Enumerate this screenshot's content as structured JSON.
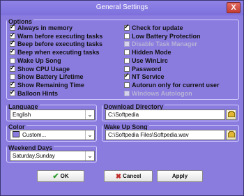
{
  "window": {
    "title": "General Settings",
    "close_label": "X"
  },
  "options": {
    "group_title": "Options",
    "left_items": [
      {
        "label": "Always in memory",
        "checked": true,
        "disabled": false
      },
      {
        "label": "Warn before executing tasks",
        "checked": true,
        "disabled": false
      },
      {
        "label": "Beep before executing tasks",
        "checked": true,
        "disabled": false
      },
      {
        "label": "Beep when executing tasks",
        "checked": true,
        "disabled": false
      },
      {
        "label": "Wake Up Song",
        "checked": false,
        "disabled": false
      },
      {
        "label": "Show CPU Usage",
        "checked": true,
        "disabled": false
      },
      {
        "label": "Show Battery Lifetime",
        "checked": false,
        "disabled": false
      },
      {
        "label": "Show Remaining Time",
        "checked": true,
        "disabled": false
      },
      {
        "label": "Balloon Hints",
        "checked": true,
        "disabled": false
      }
    ],
    "right_items": [
      {
        "label": "Check for update",
        "checked": true,
        "disabled": false
      },
      {
        "label": "Low Battery Protection",
        "checked": false,
        "disabled": false
      },
      {
        "label": "Disable Task Manager",
        "checked": false,
        "disabled": true
      },
      {
        "label": "Hidden Mode",
        "checked": false,
        "disabled": false
      },
      {
        "label": "Use WinLirc",
        "checked": false,
        "disabled": false
      },
      {
        "label": "Password",
        "checked": false,
        "disabled": false
      },
      {
        "label": "NT Service",
        "checked": true,
        "disabled": false
      },
      {
        "label": "Autorun only for current user",
        "checked": false,
        "disabled": false
      },
      {
        "label": "Windows Autologon",
        "checked": false,
        "disabled": true
      }
    ]
  },
  "language": {
    "group_title": "Language",
    "selected": "English"
  },
  "color": {
    "group_title": "Color",
    "selected": "Custom...",
    "swatch_color": "#8a7bdf"
  },
  "weekend_days": {
    "group_title": "Weekend Days",
    "selected": "Saturday,Sunday"
  },
  "download_directory": {
    "group_title": "Download Directory",
    "value": "C:\\Softpedia"
  },
  "wake_up_song": {
    "group_title": "Wake Up Song",
    "value": "C:\\Softpedia Files\\Softpedia.wav"
  },
  "buttons": {
    "ok_label": "OK",
    "cancel_label": "Cancel",
    "apply_label": "Apply"
  },
  "icons": {
    "ok_icon": "check-icon",
    "cancel_icon": "x-icon",
    "folder_icon": "folder-icon",
    "dropdown_icon": "chevron-down-icon"
  }
}
